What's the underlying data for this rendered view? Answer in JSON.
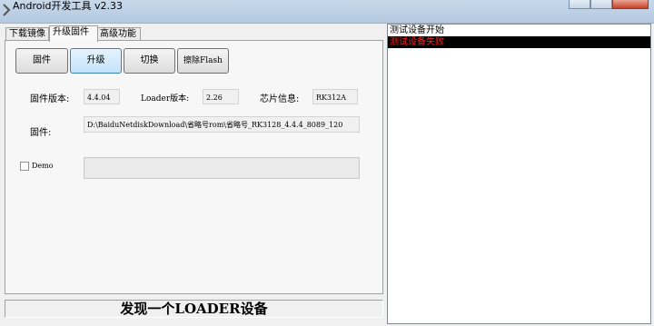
{
  "window": {
    "title": "Android开发工具 v2.33"
  },
  "tabs": [
    {
      "label": "下载镜像"
    },
    {
      "label": "升级固件"
    },
    {
      "label": "高级功能"
    }
  ],
  "toolbar": {
    "firmware_label": "固件",
    "upgrade_label": "升级",
    "switch_label": "切换",
    "erase_label": "擦除Flash"
  },
  "info": {
    "fw_version_label": "固件版本:",
    "fw_version_value": "4.4.04",
    "loader_version_label": "Loader版本:",
    "loader_version_value": "2.26",
    "chip_label": "芯片信息:",
    "chip_value": "RK312A",
    "firmware_path_label": "固件:",
    "firmware_path_value": "D:\\BaiduNetdiskDownload\\省略号rom\\省略号_RK3128_4.4.4_8089_120"
  },
  "demo": {
    "label": "Demo"
  },
  "status": {
    "text": "发现一个LOADER设备"
  },
  "log": {
    "lines": [
      {
        "text": "测试设备开始",
        "color": "#000000"
      },
      {
        "text": "测试设备失败",
        "color": "#ff2020"
      }
    ]
  },
  "colors": {
    "log_error": "#ff2020",
    "hot_button": "#c4e3f9"
  },
  "icons": {
    "app": "android-app-icon"
  }
}
